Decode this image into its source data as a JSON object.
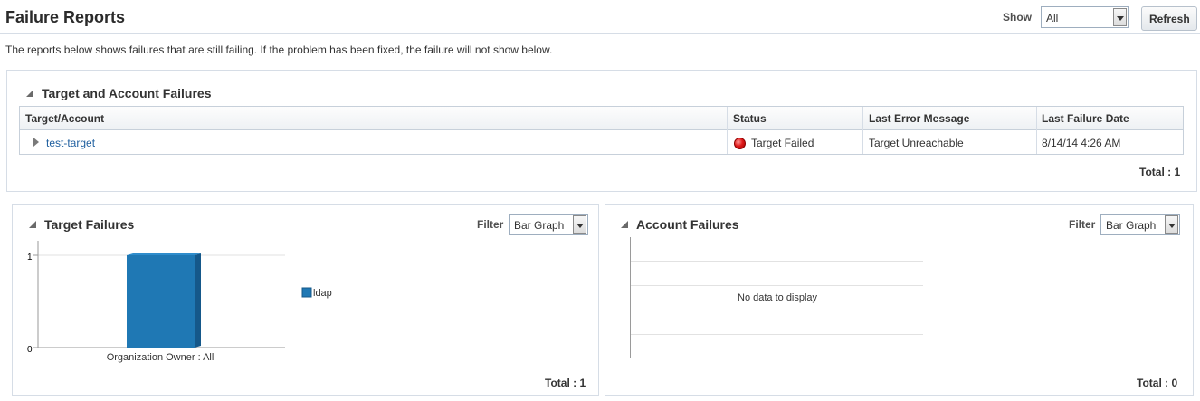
{
  "header": {
    "title": "Failure Reports",
    "show_label": "Show",
    "show_value": "All",
    "refresh_label": "Refresh"
  },
  "intro_text": "The reports below shows failures that are still failing. If the problem has been fixed, the failure will not show below.",
  "target_account_failures": {
    "title": "Target and Account Failures",
    "columns": [
      "Target/Account",
      "Status",
      "Last Error Message",
      "Last Failure Date"
    ],
    "rows": [
      {
        "target": "test-target",
        "status": "Target Failed",
        "last_error_message": "Target Unreachable",
        "last_failure_date": "8/14/14 4:26 AM"
      }
    ],
    "total": "Total : 1"
  },
  "target_failures": {
    "title": "Target Failures",
    "filter_label": "Filter",
    "filter_value": "Bar Graph",
    "total": "Total : 1"
  },
  "account_failures": {
    "title": "Account Failures",
    "filter_label": "Filter",
    "filter_value": "Bar Graph",
    "no_data": "No data to display",
    "total": "Total : 0"
  },
  "colors": {
    "bar": "#1f78b4",
    "link": "#1f5f9f",
    "status_failed": "#e01b1b"
  },
  "chart_data": [
    {
      "type": "bar",
      "categories": [
        "Organization Owner : All"
      ],
      "series": [
        {
          "name": "ldap",
          "values": [
            1
          ]
        }
      ],
      "yticks": [
        "0",
        "1"
      ],
      "ylim": [
        0,
        1
      ],
      "legend": "right"
    }
  ]
}
